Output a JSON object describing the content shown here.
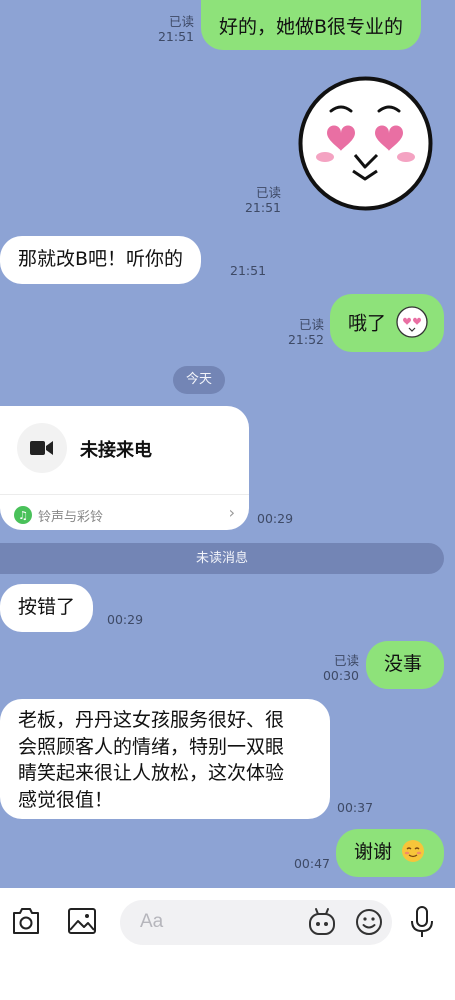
{
  "messages": [
    {
      "id": "m1",
      "text": "好的，她做B很专业的",
      "read": "已读",
      "time": "21:51"
    },
    {
      "id": "sticker",
      "read": "已读",
      "time": "21:51",
      "sticker": "heart-eyes-face-sticker"
    },
    {
      "id": "m2",
      "text": "那就改B吧！听你的",
      "time": "21:51"
    },
    {
      "id": "m3",
      "text": "哦了",
      "read": "已读",
      "time": "21:52"
    },
    {
      "id": "m4",
      "text": "按错了",
      "time": "00:29"
    },
    {
      "id": "m5",
      "text": "没事",
      "read": "已读",
      "time": "00:30"
    },
    {
      "id": "m6",
      "lines": [
        "老板，丹丹这女孩服务很好、很",
        "会照顾客人的情绪，特别一双眼",
        "睛笑起来很让人放松，这次体验",
        "感觉很值！"
      ],
      "time": "00:37"
    },
    {
      "id": "m7",
      "text": "谢谢",
      "time": "00:47"
    }
  ],
  "date_divider": "今天",
  "call_card": {
    "title": "未接来电",
    "footer": "铃声与彩铃",
    "time": "00:29"
  },
  "unread_label": "未读消息",
  "input": {
    "placeholder": "Aa"
  },
  "colors": {
    "chat_bg": "#8da3d4",
    "my_bubble": "#8ee27a",
    "their_bubble": "#ffffff"
  },
  "toolbar_icons": [
    "camera-icon",
    "image-icon",
    "sticker-icon",
    "emoji-icon",
    "microphone-icon"
  ]
}
